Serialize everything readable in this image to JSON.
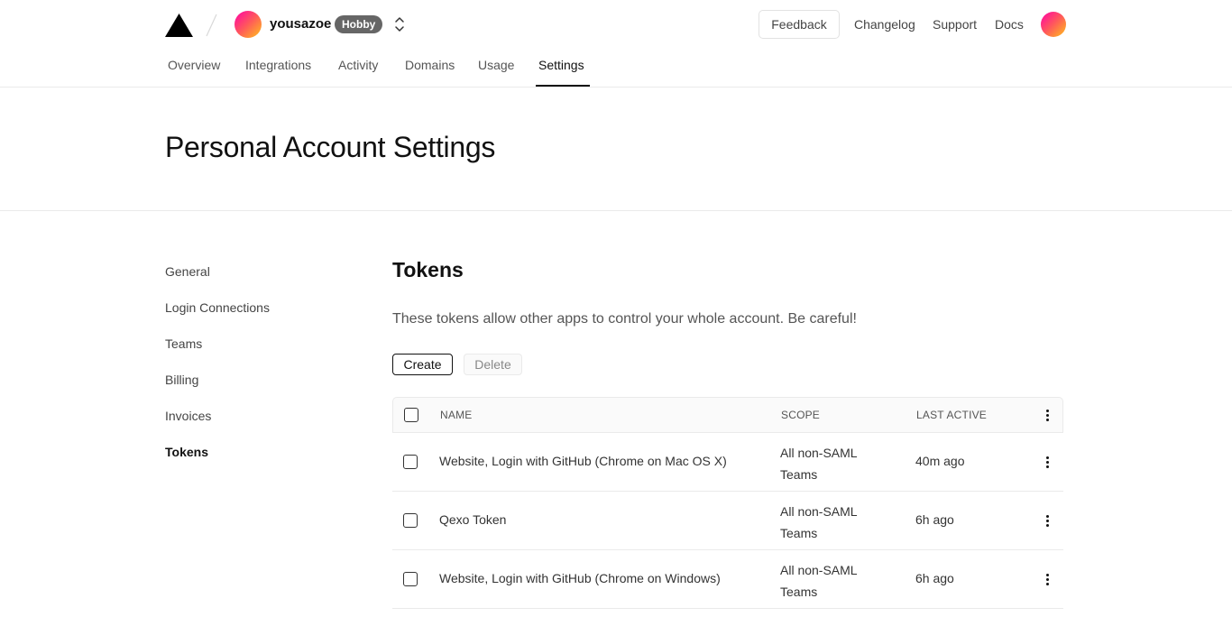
{
  "header": {
    "team_name": "yousazoe",
    "plan_badge": "Hobby",
    "feedback_label": "Feedback",
    "links": [
      "Changelog",
      "Support",
      "Docs"
    ]
  },
  "nav": {
    "tabs": [
      "Overview",
      "Integrations",
      "Activity",
      "Domains",
      "Usage",
      "Settings"
    ],
    "active": "Settings"
  },
  "page": {
    "title": "Personal Account Settings"
  },
  "sidebar": {
    "items": [
      "General",
      "Login Connections",
      "Teams",
      "Billing",
      "Invoices",
      "Tokens"
    ],
    "active": "Tokens"
  },
  "tokens": {
    "title": "Tokens",
    "description": "These tokens allow other apps to control your whole account. Be careful!",
    "create_label": "Create",
    "delete_label": "Delete",
    "columns": [
      "NAME",
      "SCOPE",
      "LAST ACTIVE"
    ],
    "rows": [
      {
        "name": "Website, Login with GitHub (Chrome on Mac OS X)",
        "scope_line1": "All non-SAML",
        "scope_line2": "Teams",
        "last_active": "40m ago"
      },
      {
        "name": "Qexo Token",
        "scope_line1": "All non-SAML",
        "scope_line2": "Teams",
        "last_active": "6h ago"
      },
      {
        "name": "Website, Login with GitHub (Chrome on Windows)",
        "scope_line1": "All non-SAML",
        "scope_line2": "Teams",
        "last_active": "6h ago"
      }
    ]
  },
  "colors": {
    "text": "#111111",
    "muted": "#555555",
    "border": "#eaeaea",
    "badge_bg": "#666666",
    "avatar_gradient": [
      "#ff00a8",
      "#ffc21a"
    ]
  },
  "icons": {
    "logo": "triangle-logo-icon",
    "divider": "slash-divider-icon",
    "switcher": "chevron-up-down-icon",
    "row_menu": "more-vertical-icon"
  }
}
